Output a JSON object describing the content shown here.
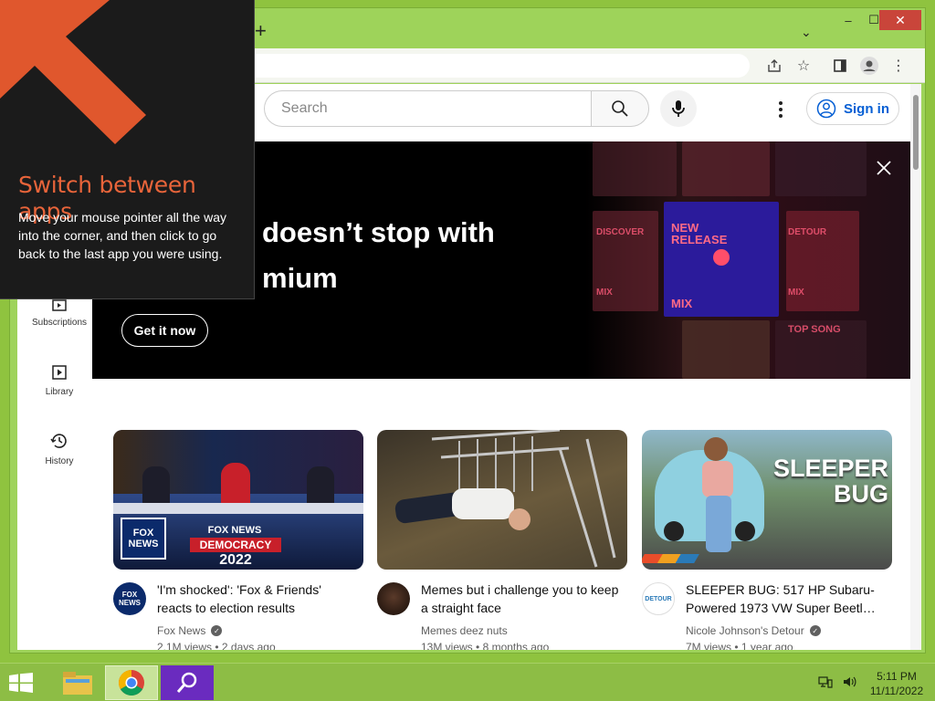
{
  "browser": {
    "new_tab_symbol": "+",
    "window_controls": {
      "minimize": "–",
      "maximize": "☐",
      "close": "✕"
    }
  },
  "youtube": {
    "search_placeholder": "Search",
    "sign_in_label": "Sign in",
    "guide": [
      {
        "label": "Subscriptions",
        "icon": "subscriptions-icon"
      },
      {
        "label": "Library",
        "icon": "library-icon"
      },
      {
        "label": "History",
        "icon": "history-icon"
      }
    ],
    "banner": {
      "headline_line1": "doesn’t stop with",
      "headline_line2": "mium",
      "cta_label": "Get it now",
      "art_labels": {
        "new_release": "NEW RELEASE",
        "mix": "MIX",
        "discover": "DISCOVER",
        "detour": "DETOUR",
        "top_songs": "TOP SONG",
        "mix_left": "MIX",
        "mix_right": "MIX"
      }
    },
    "videos": [
      {
        "title": "'I'm shocked': 'Fox & Friends' reacts to election results",
        "channel": "Fox News",
        "verified": true,
        "views": "2.1M views",
        "age": "2 days ago",
        "thumb_text_1": "FOX NEWS",
        "thumb_text_2": "DEMOCRACY",
        "thumb_text_3": "2022",
        "avatar_text": "FOX NEWS"
      },
      {
        "title": "Memes but i challenge you to keep a straight face",
        "channel": "Memes deez nuts",
        "verified": false,
        "views": "13M views",
        "age": "8 months ago"
      },
      {
        "title": "SLEEPER BUG: 517 HP Subaru-Powered 1973 VW Super Beetl…",
        "channel": "Nicole Johnson's Detour",
        "verified": true,
        "views": "7M views",
        "age": "1 year ago",
        "thumb_text_1": "SLEEPER",
        "thumb_text_2": "BUG",
        "avatar_text": "DETOUR"
      }
    ]
  },
  "hint": {
    "title": "Switch between apps",
    "body": "Move your mouse pointer all the way into the corner, and then click to go back to the last app you were using."
  },
  "taskbar": {
    "time": "5:11 PM",
    "date": "11/11/2022"
  },
  "colors": {
    "desktop": "#8fc33f",
    "hint_accent": "#e8643a",
    "youtube_blue": "#065fd4"
  }
}
